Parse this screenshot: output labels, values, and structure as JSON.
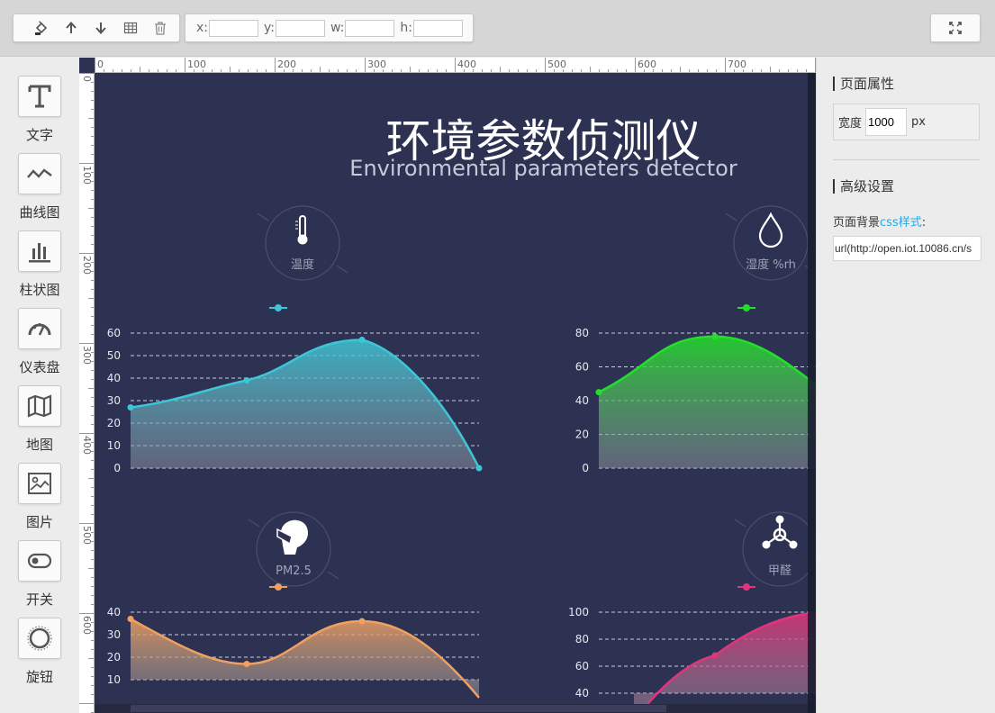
{
  "toolbar": {
    "coords": [
      {
        "label": "x:",
        "value": ""
      },
      {
        "label": "y:",
        "value": ""
      },
      {
        "label": "w:",
        "value": ""
      },
      {
        "label": "h:",
        "value": ""
      }
    ]
  },
  "sidebar": {
    "items": [
      {
        "label": "文字",
        "icon": "text-icon"
      },
      {
        "label": "曲线图",
        "icon": "line-chart-icon"
      },
      {
        "label": "柱状图",
        "icon": "bar-chart-icon"
      },
      {
        "label": "仪表盘",
        "icon": "gauge-icon"
      },
      {
        "label": "地图",
        "icon": "map-icon"
      },
      {
        "label": "图片",
        "icon": "image-icon"
      },
      {
        "label": "开关",
        "icon": "switch-icon"
      },
      {
        "label": "旋钮",
        "icon": "knob-icon"
      }
    ]
  },
  "rulers": {
    "top_ticks": [
      "0",
      "100",
      "200",
      "300",
      "400",
      "500",
      "600",
      "700"
    ],
    "left_ticks": [
      "0",
      "100",
      "200",
      "300",
      "400",
      "500",
      "600"
    ]
  },
  "canvas": {
    "title": "环境参数侦测仪",
    "subtitle": "Environmental parameters detector",
    "widgets": [
      {
        "label": "温度",
        "icon": "thermometer-icon"
      },
      {
        "label": "湿度 %rh",
        "icon": "water-drop-icon"
      },
      {
        "label": "PM2.5",
        "icon": "mask-icon"
      },
      {
        "label": "甲醛",
        "icon": "molecule-icon"
      }
    ]
  },
  "chart_data": [
    {
      "type": "area",
      "color": "#3dc6d6",
      "y_ticks": [
        "0",
        "10",
        "20",
        "30",
        "40",
        "50",
        "60"
      ],
      "ylim": [
        0,
        60
      ],
      "points_y": [
        27,
        39,
        57,
        0
      ]
    },
    {
      "type": "area",
      "color": "#22e02a",
      "y_ticks": [
        "0",
        "20",
        "40",
        "60",
        "80"
      ],
      "ylim": [
        0,
        80
      ],
      "points_y": [
        45,
        78
      ]
    },
    {
      "type": "area",
      "color": "#f0a060",
      "y_ticks": [
        "10",
        "20",
        "30",
        "40"
      ],
      "ylim": [
        10,
        40
      ],
      "points_y": [
        37,
        17,
        36
      ]
    },
    {
      "type": "area",
      "color": "#e0357a",
      "y_ticks": [
        "40",
        "60",
        "80",
        "100"
      ],
      "ylim": [
        40,
        100
      ],
      "points_y": [
        68
      ]
    }
  ],
  "right_panel": {
    "page_props_title": "页面属性",
    "width_label": "宽度",
    "width_value": "1000",
    "width_unit": "px",
    "advanced_title": "高级设置",
    "bg_label_prefix": "页面背景",
    "bg_label_link": "css样式",
    "bg_label_suffix": ":",
    "bg_value": "url(http://open.iot.10086.cn/s"
  }
}
